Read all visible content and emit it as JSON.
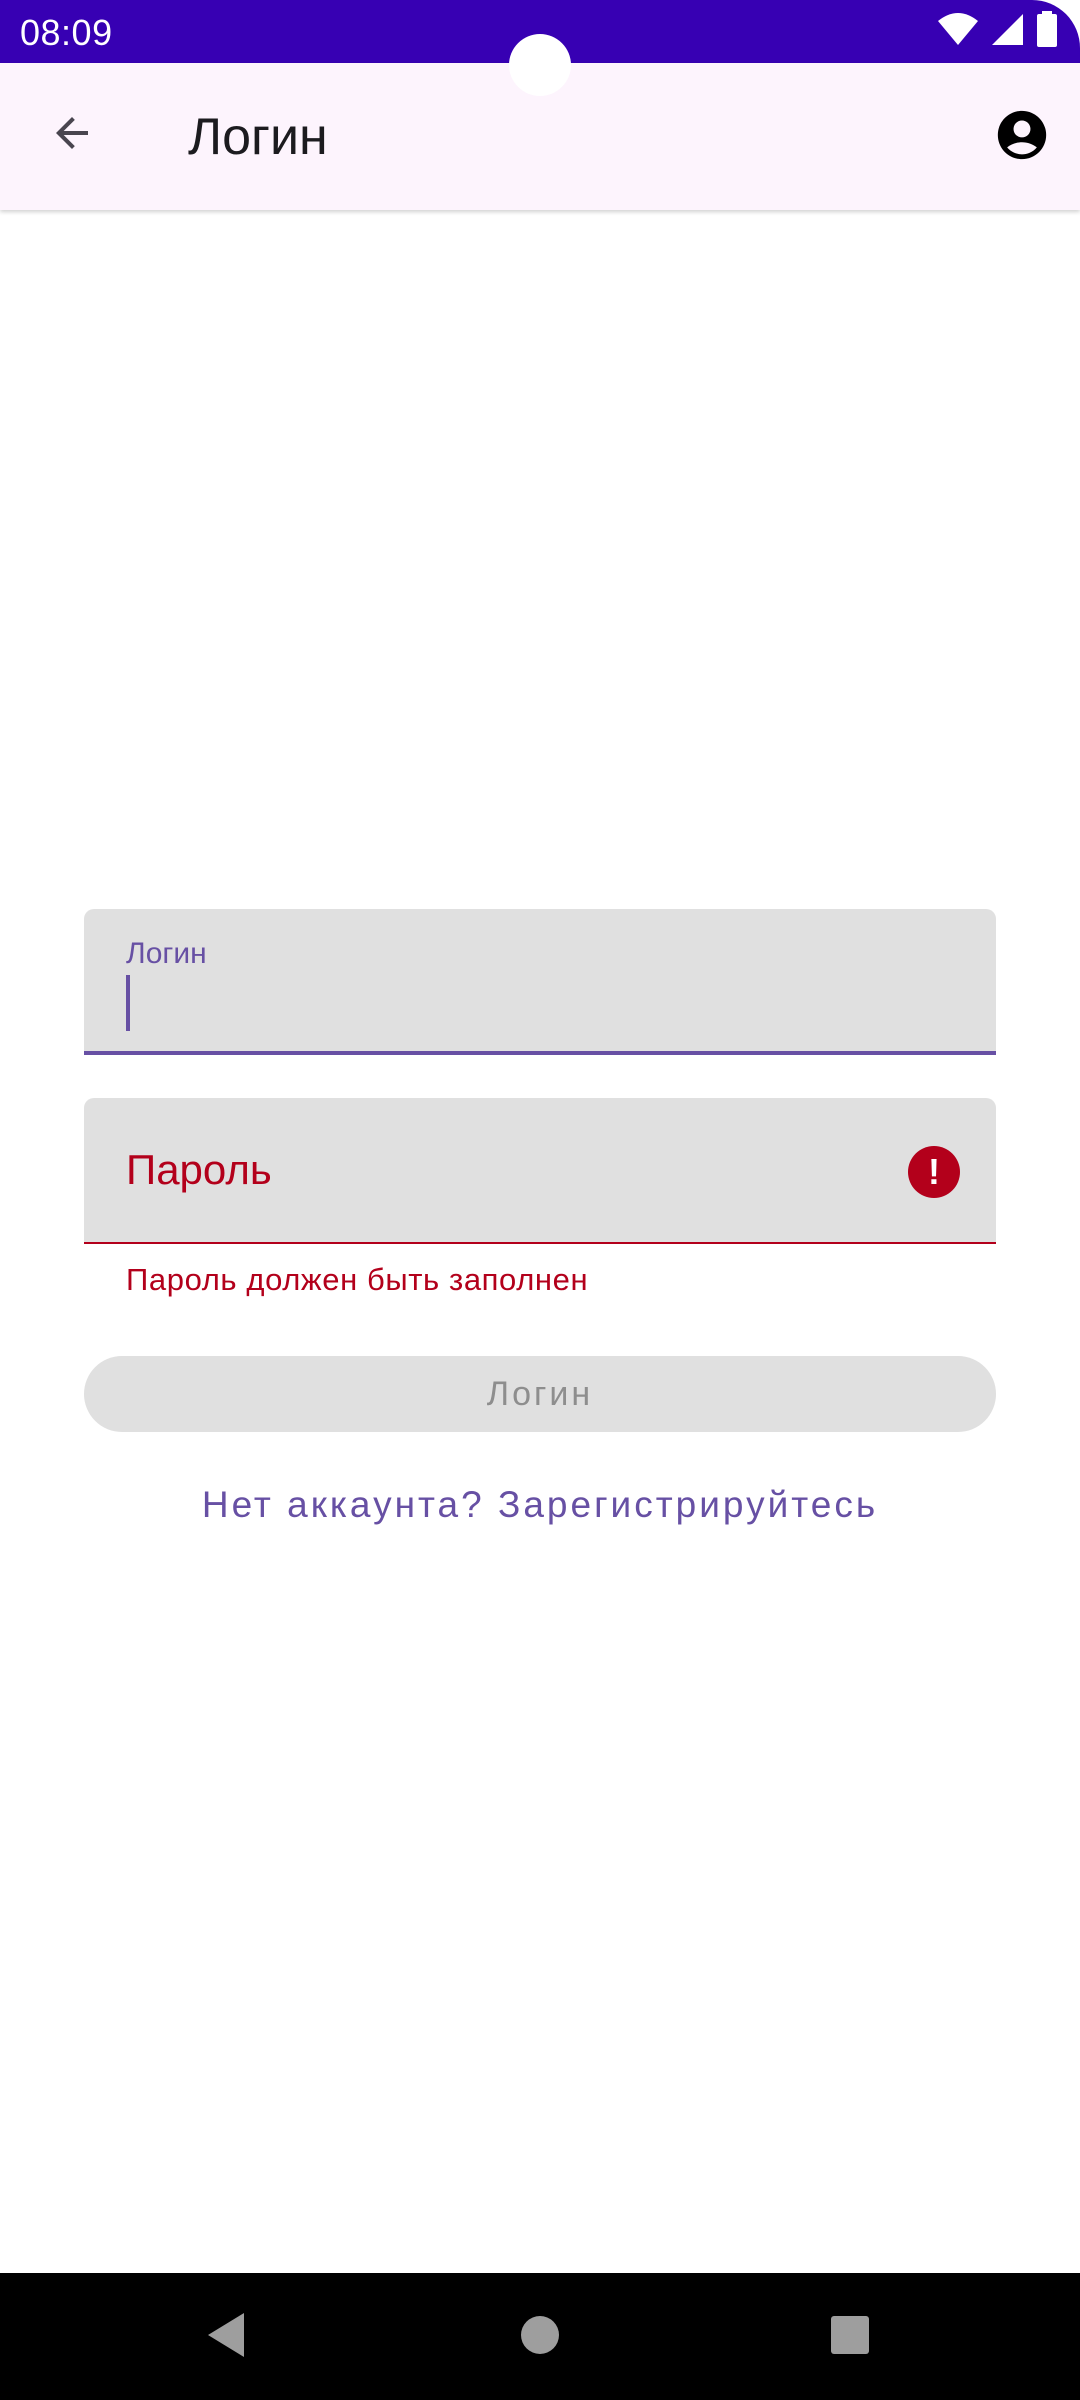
{
  "status_bar": {
    "time": "08:09",
    "icons": [
      "wifi-icon",
      "signal-icon",
      "battery-icon"
    ],
    "background": "#3700b3"
  },
  "app_bar": {
    "title": "Логин",
    "back_icon": "arrow-back-icon",
    "account_icon": "account-circle-icon",
    "background": "#fdf4fd"
  },
  "form": {
    "login_field": {
      "label": "Логин",
      "value": "",
      "state": "focused"
    },
    "password_field": {
      "placeholder": "Пароль",
      "value": "",
      "state": "error",
      "error_icon": "error-icon",
      "error_message": "Пароль должен быть заполнен"
    },
    "login_button": {
      "label": "Логин",
      "enabled": false
    },
    "register_link": "Нет аккаунта? Зарегистрируйтесь"
  },
  "colors": {
    "accent": "#6750a4",
    "error": "#b3001b",
    "field_background": "#e0e0e0"
  },
  "nav_bar": {
    "buttons": [
      "nav-back-icon",
      "nav-home-icon",
      "nav-recents-icon"
    ]
  }
}
